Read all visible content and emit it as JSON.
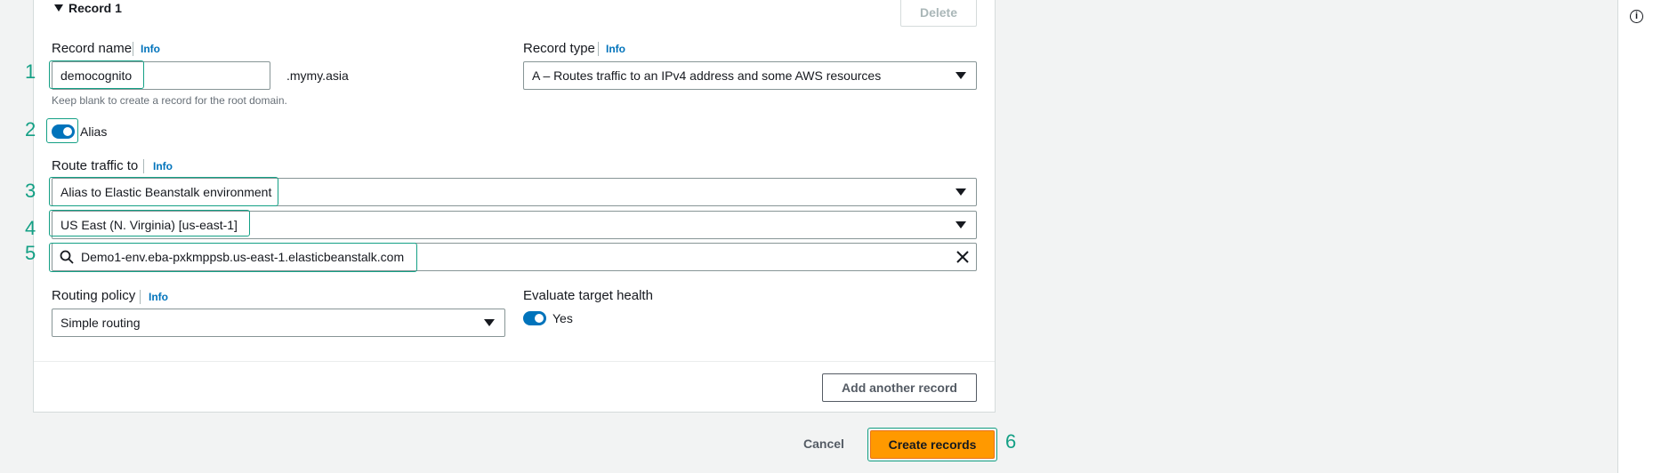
{
  "record": {
    "header_label": "Record 1",
    "delete_label": "Delete"
  },
  "record_name": {
    "label": "Record name",
    "info": "Info",
    "value": "democognito",
    "suffix": ".mymy.asia",
    "hint": "Keep blank to create a record for the root domain."
  },
  "record_type": {
    "label": "Record type",
    "info": "Info",
    "value": "A – Routes traffic to an IPv4 address and some AWS resources"
  },
  "alias": {
    "label": "Alias",
    "enabled": true
  },
  "route_traffic": {
    "label": "Route traffic to",
    "info": "Info",
    "endpoint": "Alias to Elastic Beanstalk environment",
    "region": "US East (N. Virginia) [us-east-1]",
    "environment": "Demo1-env.eba-pxkmppsb.us-east-1.elasticbeanstalk.com"
  },
  "routing_policy": {
    "label": "Routing policy",
    "info": "Info",
    "value": "Simple routing"
  },
  "evaluate_health": {
    "label": "Evaluate target health",
    "value": "Yes",
    "enabled": true
  },
  "buttons": {
    "add_another": "Add another record",
    "cancel": "Cancel",
    "create": "Create records"
  },
  "annotations": [
    "1",
    "2",
    "3",
    "4",
    "5",
    "6"
  ],
  "colors": {
    "accent_orange": "#ff9900",
    "link_blue": "#0073bb",
    "annotation_teal": "#14a085"
  },
  "icons": {
    "collapse": "caret-down-icon",
    "search": "search-icon",
    "clear": "close-icon",
    "dropdown": "dropdown-arrow-icon",
    "panel_info": "info-circle-icon"
  }
}
